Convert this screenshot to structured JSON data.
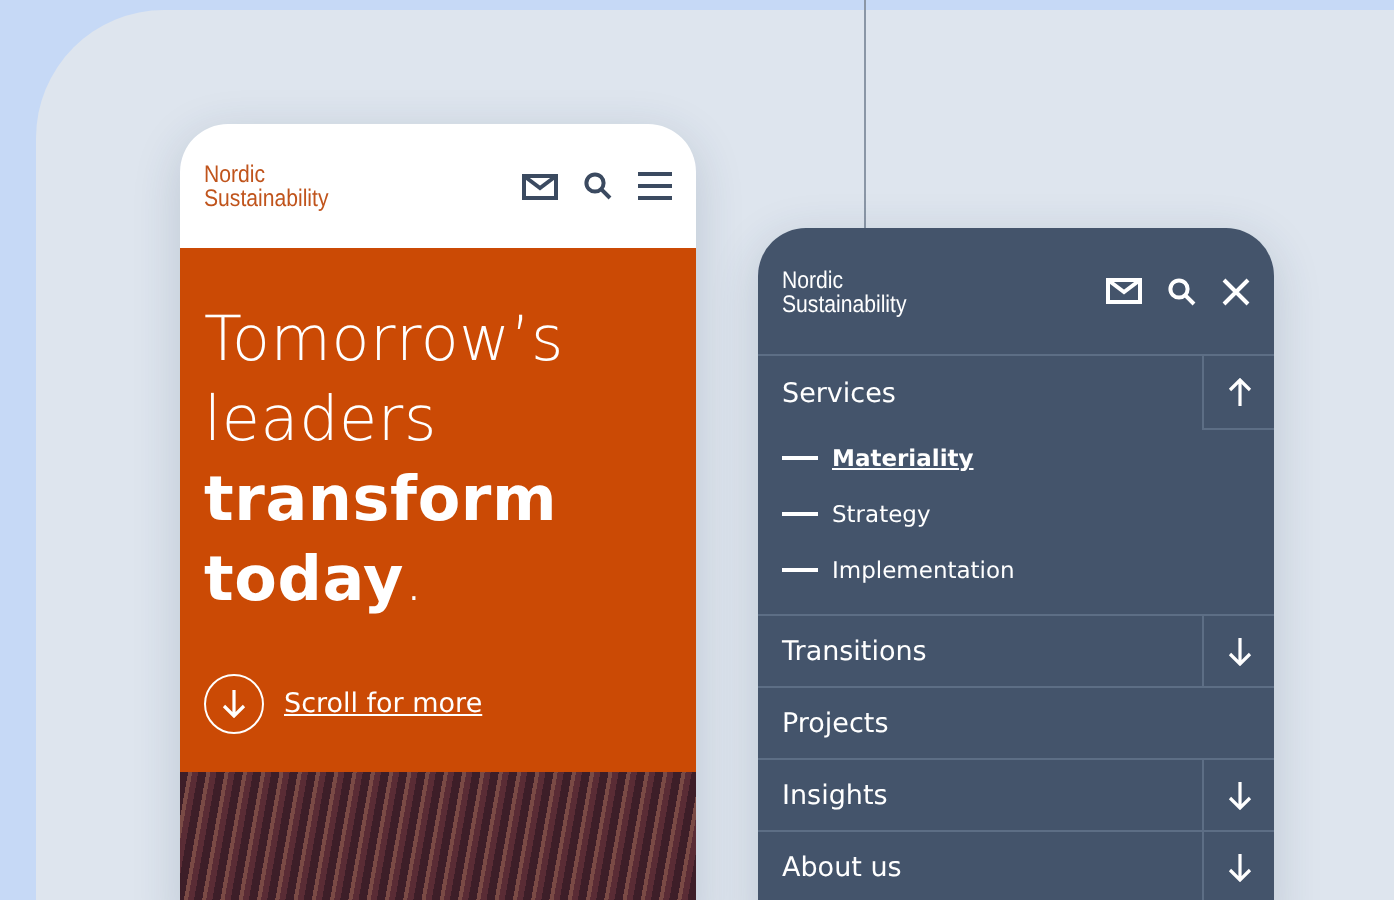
{
  "phone_left": {
    "logo": [
      "Nordic",
      "Sustainability"
    ],
    "headline": "Tomorrow’s leaders **transform today**.",
    "scroll_link": "Scroll for more"
  },
  "phone_right": {
    "logo": [
      "Nordic",
      "Sustainability"
    ],
    "menu": [
      {
        "label": "Services",
        "kind": "expandable",
        "expanded": true,
        "children": [
          {
            "label": "Materiality",
            "selected": true
          },
          {
            "label": "Strategy",
            "selected": false
          },
          {
            "label": "Implementation",
            "selected": false
          }
        ]
      },
      {
        "label": "Transitions",
        "kind": "expandable",
        "expanded": false
      },
      {
        "label": "Projects",
        "kind": "link"
      },
      {
        "label": "Insights",
        "kind": "expandable",
        "expanded": false
      },
      {
        "label": "About us",
        "kind": "expandable",
        "expanded": false
      }
    ]
  }
}
